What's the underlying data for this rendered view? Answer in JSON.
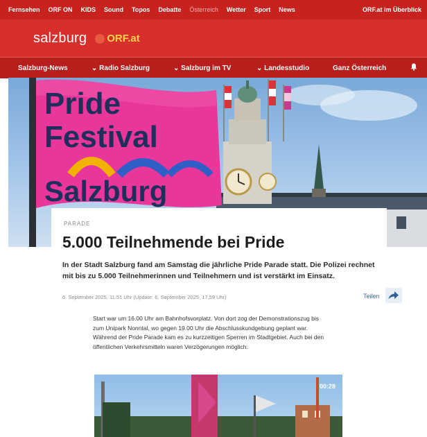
{
  "top_nav": {
    "items": [
      "Fernsehen",
      "ORF ON",
      "KIDS",
      "Sound",
      "Topos",
      "Debatte",
      "Österreich",
      "Wetter",
      "Sport",
      "News",
      "ORF.at im Überblick"
    ]
  },
  "brand": {
    "name": "salzburg",
    "orf_label": "ORF.at"
  },
  "sub_nav": {
    "items": [
      {
        "label": "Salzburg-News"
      },
      {
        "label": "Radio Salzburg"
      },
      {
        "label": "Salzburg im TV"
      },
      {
        "label": "Landesstudio"
      },
      {
        "label": "Ganz Österreich"
      }
    ],
    "bell_icon": "bell-icon"
  },
  "hero": {
    "flag_text": [
      "Pride",
      "Festival",
      "Salzburg"
    ],
    "flag_color": "#e8369a"
  },
  "article": {
    "kicker": "PARADE",
    "headline": "5.000 Teilnehmende bei Pride",
    "lead": "In der Stadt Salzburg fand am Samstag die jährliche Pride Parade statt. Die Polizei rechnet mit bis zu 5.000 Teilnehmerinnen und Teilnehmern und ist verstärkt im Einsatz.",
    "dateline": "6. September 2025, 11.51 Uhr (Update: 6. September 2025, 17.59 Uhr)",
    "share_label": "Teilen",
    "body": "Start war um 16.00 Uhr am Bahnhofsvorplatz. Von dort zog der Demonstrationszug bis zum Unipark Nonntal, wo gegen 19.00 Uhr die Abschlusskundgebung geplant war. Während der Pride Parade kam es zu kurzzeitigen Sperren im Stadtgebiet. Auch bei den öffentlichen Verkehrsmitteln waren Verzögerungen möglich.",
    "video_duration": "00:28"
  },
  "colors": {
    "brand_red": "#d7302c",
    "top_red": "#c8221f",
    "sub_red": "#b81e1b",
    "accent_yellow": "#ffd24a",
    "link_blue": "#3a6ea5"
  }
}
